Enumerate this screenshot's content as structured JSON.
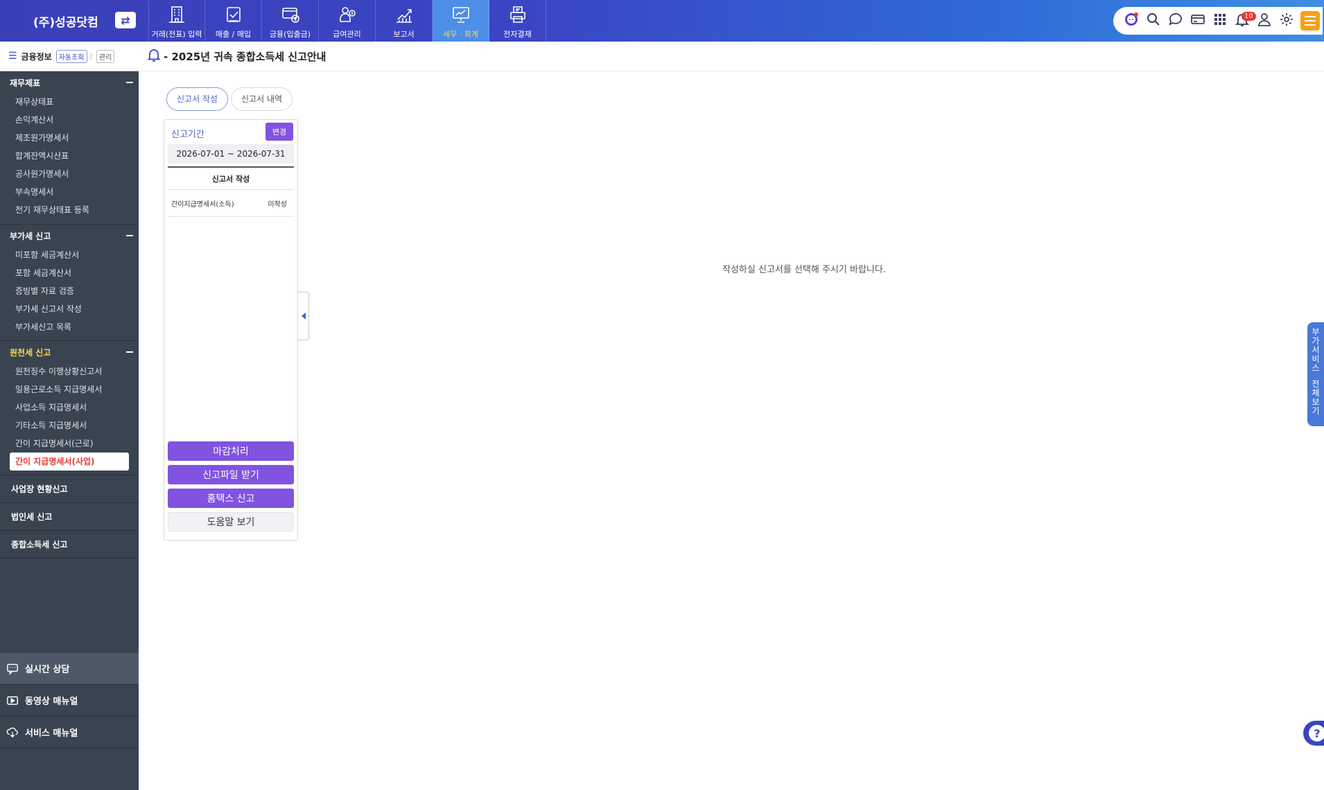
{
  "header": {
    "company": "(주)성공닷컴",
    "nav": [
      {
        "label": "거래(전표) 입력",
        "icon": "building-icon"
      },
      {
        "label": "매출 / 매입",
        "icon": "invoice-check-icon"
      },
      {
        "label": "금융(입출금)",
        "icon": "bank-card-icon"
      },
      {
        "label": "급여관리",
        "icon": "payroll-person-icon"
      },
      {
        "label": "보고서",
        "icon": "report-chart-icon"
      },
      {
        "label": "세무 · 회계",
        "icon": "tax-board-icon"
      },
      {
        "label": "전자결재",
        "icon": "approval-printer-icon"
      }
    ],
    "notification_count": "10"
  },
  "sidebar": {
    "fin_title": "금융정보",
    "fin_auto": "자동조회",
    "fin_manage": "관리",
    "groups": [
      {
        "title": "재무제표",
        "items": [
          "재무상태표",
          "손익계산서",
          "제조원가명세서",
          "합계잔액시산표",
          "공사원가명세서",
          "부속명세서",
          "전기 재무상태표 등록"
        ]
      },
      {
        "title": "부가세 신고",
        "items": [
          "미포함 세금계산서",
          "포함 세금계산서",
          "증빙별 자료 검증",
          "부가세 신고서 작성",
          "부가세신고 목록"
        ]
      },
      {
        "title": "원천세 신고",
        "items": [
          "원천징수 이행상황신고서",
          "일용근로소득 지급명세서",
          "사업소득 지급명세서",
          "기타소득 지급명세서",
          "간이 지급명세서(근로)",
          "간이 지급명세서(사업)"
        ]
      }
    ],
    "solo_groups": [
      "사업장 현황신고",
      "법인세 신고",
      "종합소득세 신고"
    ],
    "bottom_links": [
      {
        "label": "실시간 상담",
        "icon": "chat-icon"
      },
      {
        "label": "동영상 매뉴얼",
        "icon": "video-play-icon"
      },
      {
        "label": "서비스 매뉴얼",
        "icon": "cloud-download-icon"
      }
    ]
  },
  "page": {
    "title": "- 2025년 귀속 종합소득세 신고안내",
    "tabs": [
      "신고서 작성",
      "신고서 내역"
    ],
    "period_label": "신고기간",
    "change_label": "변경",
    "period_range": "2026-07-01 ~ 2026-07-31",
    "form_header": "신고서 작성",
    "form_row": {
      "name": "간이지급명세서(소득)",
      "status": "미작성"
    },
    "buttons": {
      "close": "마감처리",
      "download": "신고파일 받기",
      "hometax": "홈택스 신고",
      "help": "도움말 보기"
    },
    "empty_message": "작성하실 신고서를 선택해 주시기 바랍니다."
  },
  "side_service": {
    "line1": [
      "부",
      "가",
      "서",
      "비",
      "스"
    ],
    "line2": [
      "전",
      "체",
      "보",
      "기"
    ]
  },
  "colors": {
    "accent": "#8053e0",
    "brand": "#3a45c4",
    "sidebar": "#3a4350",
    "active_item": "#e53935"
  }
}
